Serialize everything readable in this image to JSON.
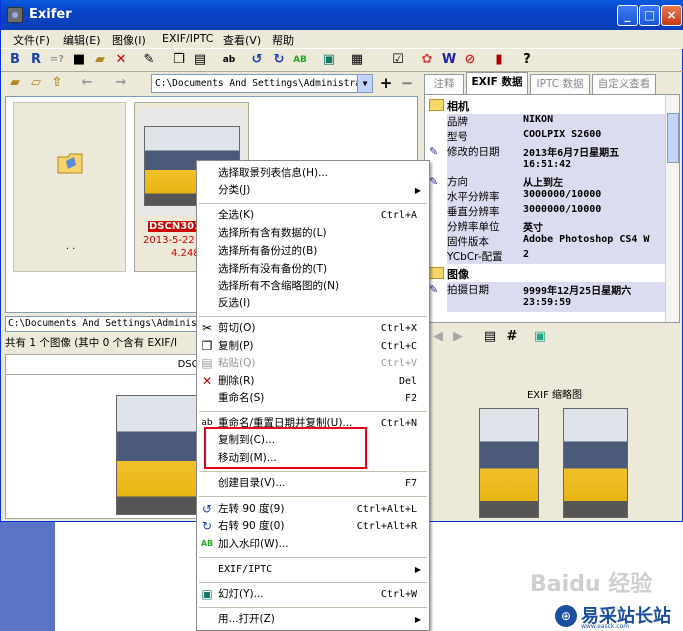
{
  "window": {
    "title": "Exifer"
  },
  "menubar": [
    "文件(F)",
    "编辑(E)",
    "图像(I)",
    "EXIF/IPTC",
    "查看(V)",
    "帮助"
  ],
  "toolbar": {
    "b_label": "B",
    "r_label": "R"
  },
  "path_combo": "C:\\Documents And Settings\\Administrat",
  "folder_item": {
    "label": ". ."
  },
  "thumbnail": {
    "name": "DSCN3019",
    "date": "2013-5-22",
    "size": "4.248"
  },
  "path_bar": "C:\\Documents And Settings\\Administ",
  "status": "共有 1 个图像 (其中 0 个含有 EXIF/I",
  "preview_header": "DSCN301900.",
  "tabs": [
    "注释",
    "EXIF 数据",
    "IPTC 数据",
    "自定义查看"
  ],
  "exif": {
    "camera_header": "相机",
    "rows": [
      {
        "k": "品牌",
        "v": "NIKON"
      },
      {
        "k": "型号",
        "v": "COOLPIX S2600"
      },
      {
        "k": "修改的日期",
        "v": "2013年6月7日星期五"
      },
      {
        "k": "",
        "v": "16:51:42"
      },
      {
        "k": "方向",
        "v": "从上到左"
      },
      {
        "k": "水平分辨率",
        "v": "3000000/10000"
      },
      {
        "k": "垂直分辨率",
        "v": "3000000/10000"
      },
      {
        "k": "分辨率单位",
        "v": "英寸"
      },
      {
        "k": "固件版本",
        "v": "Adobe Photoshop CS4 W"
      },
      {
        "k": "YCbCr-配置",
        "v": "2"
      }
    ],
    "image_header": "图像",
    "image_rows": [
      {
        "k": "拍摄日期",
        "v": "9999年12月25日星期六"
      },
      {
        "k": "",
        "v": "23:59:59"
      }
    ]
  },
  "exif_thumb_header": "EXIF 缩略图",
  "context_menu": {
    "items": [
      {
        "label": "选择取景列表信息(H)...",
        "shortcut": ""
      },
      {
        "label": "分类(J)",
        "shortcut": ""
      },
      {
        "label": "全选(K)",
        "shortcut": "Ctrl+A"
      },
      {
        "label": "选择所有含有数据的(L)",
        "shortcut": ""
      },
      {
        "label": "选择所有备份过的(B)",
        "shortcut": ""
      },
      {
        "label": "选择所有没有备份的(T)",
        "shortcut": ""
      },
      {
        "label": "选择所有不含缩略图的(N)",
        "shortcut": ""
      },
      {
        "label": "反选(I)",
        "shortcut": ""
      },
      {
        "label": "剪切(O)",
        "shortcut": "Ctrl+X"
      },
      {
        "label": "复制(P)",
        "shortcut": "Ctrl+C"
      },
      {
        "label": "粘贴(Q)",
        "shortcut": "Ctrl+V"
      },
      {
        "label": "删除(R)",
        "shortcut": "Del"
      },
      {
        "label": "重命名(S)",
        "shortcut": "F2"
      },
      {
        "label": "重命名/重置日期并复制(U)...",
        "shortcut": "Ctrl+N"
      },
      {
        "label": "复制到(C)...",
        "shortcut": ""
      },
      {
        "label": "移动到(M)...",
        "shortcut": ""
      },
      {
        "label": "创建目录(V)...",
        "shortcut": "F7"
      },
      {
        "label": "左转 90 度(9)",
        "shortcut": "Ctrl+Alt+L"
      },
      {
        "label": "右转 90 度(0)",
        "shortcut": "Ctrl+Alt+R"
      },
      {
        "label": "加入水印(W)...",
        "shortcut": ""
      },
      {
        "label": "EXIF/IPTC",
        "shortcut": ""
      },
      {
        "label": "幻灯(Y)...",
        "shortcut": "Ctrl+W"
      },
      {
        "label": "用...打开(Z)",
        "shortcut": ""
      }
    ]
  },
  "watermark": {
    "baidu": "Baidu 经验",
    "site": "易采站长站",
    "url": "www.easck.com"
  },
  "colors": {
    "titlebar": "#0a4fd8",
    "highlight_box": "#e3001b",
    "selection": "#dcdcf0"
  }
}
